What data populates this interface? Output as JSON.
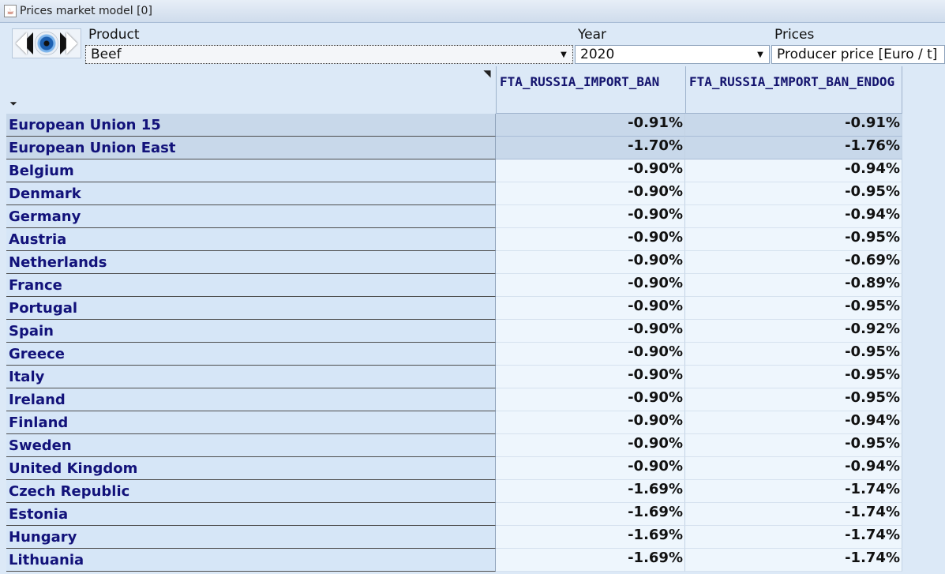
{
  "window": {
    "title": "Prices market model [0]"
  },
  "selectors": {
    "product": {
      "label": "Product",
      "value": "Beef"
    },
    "year": {
      "label": "Year",
      "value": "2020"
    },
    "prices": {
      "label": "Prices",
      "value": "Producer price [Euro / t]"
    }
  },
  "table": {
    "columns": [
      "FTA_RUSSIA_IMPORT_BAN",
      "FTA_RUSSIA_IMPORT_BAN_ENDOG"
    ],
    "rows": [
      {
        "name": "European Union 15",
        "values": [
          "-0.91%",
          "-0.91%"
        ]
      },
      {
        "name": "European Union East",
        "values": [
          "-1.70%",
          "-1.76%"
        ]
      },
      {
        "name": "Belgium",
        "values": [
          "-0.90%",
          "-0.94%"
        ]
      },
      {
        "name": "Denmark",
        "values": [
          "-0.90%",
          "-0.95%"
        ]
      },
      {
        "name": "Germany",
        "values": [
          "-0.90%",
          "-0.94%"
        ]
      },
      {
        "name": "Austria",
        "values": [
          "-0.90%",
          "-0.95%"
        ]
      },
      {
        "name": "Netherlands",
        "values": [
          "-0.90%",
          "-0.69%"
        ]
      },
      {
        "name": "France",
        "values": [
          "-0.90%",
          "-0.89%"
        ]
      },
      {
        "name": "Portugal",
        "values": [
          "-0.90%",
          "-0.95%"
        ]
      },
      {
        "name": "Spain",
        "values": [
          "-0.90%",
          "-0.92%"
        ]
      },
      {
        "name": "Greece",
        "values": [
          "-0.90%",
          "-0.95%"
        ]
      },
      {
        "name": "Italy",
        "values": [
          "-0.90%",
          "-0.95%"
        ]
      },
      {
        "name": "Ireland",
        "values": [
          "-0.90%",
          "-0.95%"
        ]
      },
      {
        "name": "Finland",
        "values": [
          "-0.90%",
          "-0.94%"
        ]
      },
      {
        "name": "Sweden",
        "values": [
          "-0.90%",
          "-0.95%"
        ]
      },
      {
        "name": "United Kingdom",
        "values": [
          "-0.90%",
          "-0.94%"
        ]
      },
      {
        "name": "Czech Republic",
        "values": [
          "-1.69%",
          "-1.74%"
        ]
      },
      {
        "name": "Estonia",
        "values": [
          "-1.69%",
          "-1.74%"
        ]
      },
      {
        "name": "Hungary",
        "values": [
          "-1.69%",
          "-1.74%"
        ]
      },
      {
        "name": "Lithuania",
        "values": [
          "-1.69%",
          "-1.74%"
        ]
      }
    ]
  }
}
